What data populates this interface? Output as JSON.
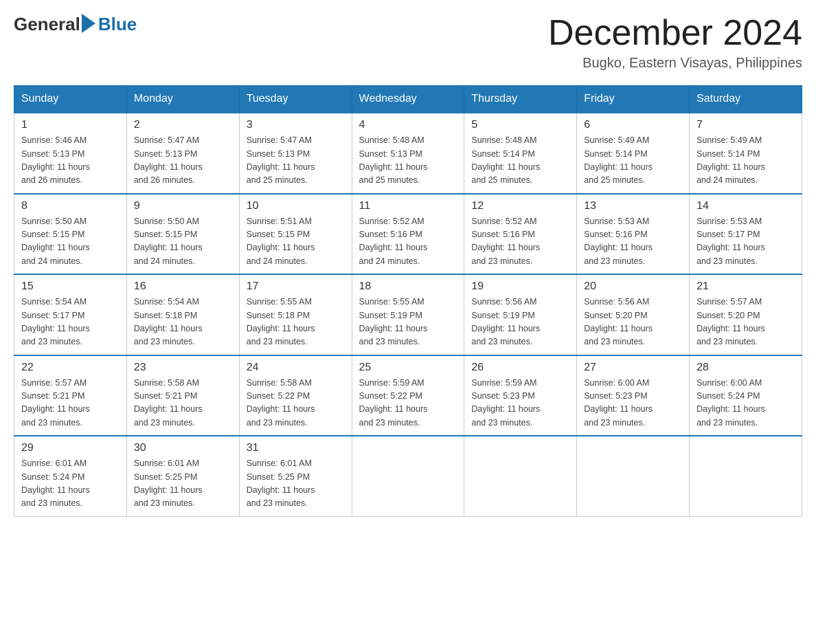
{
  "header": {
    "logo_general": "General",
    "logo_blue": "Blue",
    "month_title": "December 2024",
    "subtitle": "Bugko, Eastern Visayas, Philippines"
  },
  "days_of_week": [
    "Sunday",
    "Monday",
    "Tuesday",
    "Wednesday",
    "Thursday",
    "Friday",
    "Saturday"
  ],
  "weeks": [
    [
      {
        "day": "1",
        "sunrise": "5:46 AM",
        "sunset": "5:13 PM",
        "daylight": "11 hours and 26 minutes."
      },
      {
        "day": "2",
        "sunrise": "5:47 AM",
        "sunset": "5:13 PM",
        "daylight": "11 hours and 26 minutes."
      },
      {
        "day": "3",
        "sunrise": "5:47 AM",
        "sunset": "5:13 PM",
        "daylight": "11 hours and 25 minutes."
      },
      {
        "day": "4",
        "sunrise": "5:48 AM",
        "sunset": "5:13 PM",
        "daylight": "11 hours and 25 minutes."
      },
      {
        "day": "5",
        "sunrise": "5:48 AM",
        "sunset": "5:14 PM",
        "daylight": "11 hours and 25 minutes."
      },
      {
        "day": "6",
        "sunrise": "5:49 AM",
        "sunset": "5:14 PM",
        "daylight": "11 hours and 25 minutes."
      },
      {
        "day": "7",
        "sunrise": "5:49 AM",
        "sunset": "5:14 PM",
        "daylight": "11 hours and 24 minutes."
      }
    ],
    [
      {
        "day": "8",
        "sunrise": "5:50 AM",
        "sunset": "5:15 PM",
        "daylight": "11 hours and 24 minutes."
      },
      {
        "day": "9",
        "sunrise": "5:50 AM",
        "sunset": "5:15 PM",
        "daylight": "11 hours and 24 minutes."
      },
      {
        "day": "10",
        "sunrise": "5:51 AM",
        "sunset": "5:15 PM",
        "daylight": "11 hours and 24 minutes."
      },
      {
        "day": "11",
        "sunrise": "5:52 AM",
        "sunset": "5:16 PM",
        "daylight": "11 hours and 24 minutes."
      },
      {
        "day": "12",
        "sunrise": "5:52 AM",
        "sunset": "5:16 PM",
        "daylight": "11 hours and 23 minutes."
      },
      {
        "day": "13",
        "sunrise": "5:53 AM",
        "sunset": "5:16 PM",
        "daylight": "11 hours and 23 minutes."
      },
      {
        "day": "14",
        "sunrise": "5:53 AM",
        "sunset": "5:17 PM",
        "daylight": "11 hours and 23 minutes."
      }
    ],
    [
      {
        "day": "15",
        "sunrise": "5:54 AM",
        "sunset": "5:17 PM",
        "daylight": "11 hours and 23 minutes."
      },
      {
        "day": "16",
        "sunrise": "5:54 AM",
        "sunset": "5:18 PM",
        "daylight": "11 hours and 23 minutes."
      },
      {
        "day": "17",
        "sunrise": "5:55 AM",
        "sunset": "5:18 PM",
        "daylight": "11 hours and 23 minutes."
      },
      {
        "day": "18",
        "sunrise": "5:55 AM",
        "sunset": "5:19 PM",
        "daylight": "11 hours and 23 minutes."
      },
      {
        "day": "19",
        "sunrise": "5:56 AM",
        "sunset": "5:19 PM",
        "daylight": "11 hours and 23 minutes."
      },
      {
        "day": "20",
        "sunrise": "5:56 AM",
        "sunset": "5:20 PM",
        "daylight": "11 hours and 23 minutes."
      },
      {
        "day": "21",
        "sunrise": "5:57 AM",
        "sunset": "5:20 PM",
        "daylight": "11 hours and 23 minutes."
      }
    ],
    [
      {
        "day": "22",
        "sunrise": "5:57 AM",
        "sunset": "5:21 PM",
        "daylight": "11 hours and 23 minutes."
      },
      {
        "day": "23",
        "sunrise": "5:58 AM",
        "sunset": "5:21 PM",
        "daylight": "11 hours and 23 minutes."
      },
      {
        "day": "24",
        "sunrise": "5:58 AM",
        "sunset": "5:22 PM",
        "daylight": "11 hours and 23 minutes."
      },
      {
        "day": "25",
        "sunrise": "5:59 AM",
        "sunset": "5:22 PM",
        "daylight": "11 hours and 23 minutes."
      },
      {
        "day": "26",
        "sunrise": "5:59 AM",
        "sunset": "5:23 PM",
        "daylight": "11 hours and 23 minutes."
      },
      {
        "day": "27",
        "sunrise": "6:00 AM",
        "sunset": "5:23 PM",
        "daylight": "11 hours and 23 minutes."
      },
      {
        "day": "28",
        "sunrise": "6:00 AM",
        "sunset": "5:24 PM",
        "daylight": "11 hours and 23 minutes."
      }
    ],
    [
      {
        "day": "29",
        "sunrise": "6:01 AM",
        "sunset": "5:24 PM",
        "daylight": "11 hours and 23 minutes."
      },
      {
        "day": "30",
        "sunrise": "6:01 AM",
        "sunset": "5:25 PM",
        "daylight": "11 hours and 23 minutes."
      },
      {
        "day": "31",
        "sunrise": "6:01 AM",
        "sunset": "5:25 PM",
        "daylight": "11 hours and 23 minutes."
      },
      null,
      null,
      null,
      null
    ]
  ],
  "labels": {
    "sunrise": "Sunrise:",
    "sunset": "Sunset:",
    "daylight": "Daylight:"
  }
}
